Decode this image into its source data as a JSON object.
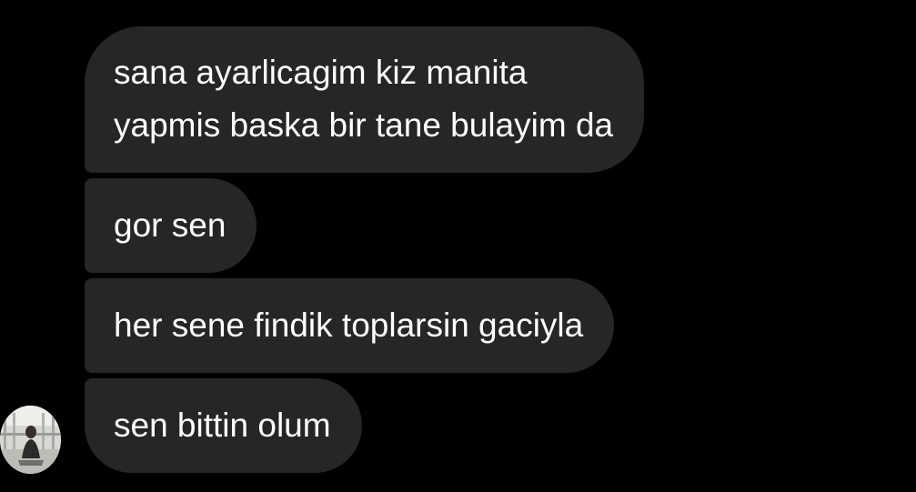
{
  "conversation": {
    "messages": [
      {
        "sender": "other",
        "lines": [
          "sana ayarlicagim kiz manita",
          "yapmis baska bir tane bulayim da"
        ]
      },
      {
        "sender": "other",
        "lines": [
          "gor sen"
        ]
      },
      {
        "sender": "other",
        "lines": [
          "her sene findik toplarsin gaciyla"
        ]
      },
      {
        "sender": "other",
        "lines": [
          "sen bittin olum"
        ]
      }
    ]
  },
  "colors": {
    "background": "#000000",
    "bubble": "#262626",
    "text": "#ffffff"
  },
  "icons": {
    "avatar": "profile-photo"
  }
}
